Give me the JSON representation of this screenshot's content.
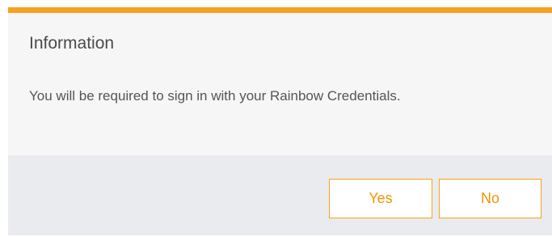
{
  "dialog": {
    "title": "Information",
    "message": "You will be required to sign in with your Rainbow Credentials.",
    "buttons": {
      "yes_label": "Yes",
      "no_label": "No"
    }
  },
  "colors": {
    "accent": "#f6a21e",
    "button_text": "#f29400",
    "body_background": "#f6f6f6",
    "footer_background": "#e9ebef"
  }
}
